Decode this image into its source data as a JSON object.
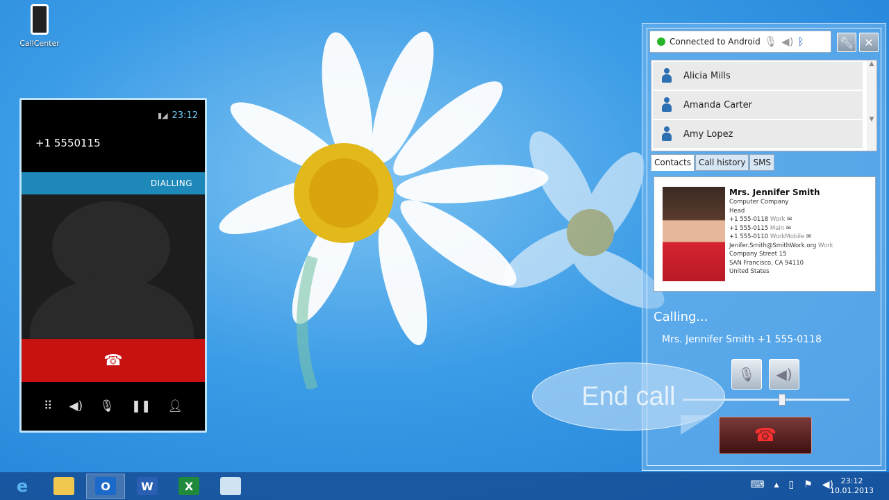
{
  "desktop": {
    "icon_label": "CallCenter"
  },
  "phone": {
    "status_time": "23:12",
    "number": "+1 5550115",
    "status_label": "DIALLING",
    "end_icon": "☎",
    "controls": [
      "dialpad-icon",
      "speaker-icon",
      "mute-icon",
      "hold-icon",
      "add-call-icon"
    ]
  },
  "panel": {
    "connection_text": "Connected to Android Phone",
    "contacts": [
      "Alicia Mills",
      "Amanda Carter",
      "Amy Lopez"
    ],
    "tabs": [
      "Contacts",
      "Call history",
      "SMS"
    ],
    "card": {
      "name": "Mrs. Jennifer Smith",
      "company": "Computer Company",
      "title": "Head",
      "phones": [
        {
          "number": "+1 555-0118",
          "label": "Work"
        },
        {
          "number": "+1 555-0115",
          "label": "Main"
        },
        {
          "number": "+1 555-0110",
          "label": "WorkMobile"
        }
      ],
      "email": "Jenifer.Smith@SmithWork.org",
      "email_label": "Work",
      "street": "Company Street 15",
      "city": "SAN Francisco, CA 94110",
      "country": "United States"
    },
    "calling": "Calling...",
    "callee": "Mrs. Jennifer Smith +1 555-0118",
    "volume": 0.6
  },
  "tooltip": "End call",
  "taskbar": {
    "apps": [
      "ie-icon",
      "explorer-icon",
      "outlook-icon",
      "word-icon",
      "excel-icon",
      "notepad-icon"
    ],
    "time": "23:12",
    "date": "10.01.2013"
  },
  "colors": {
    "connected": "#27b427",
    "end_call": "#c81212",
    "accent": "#1e88b8"
  }
}
